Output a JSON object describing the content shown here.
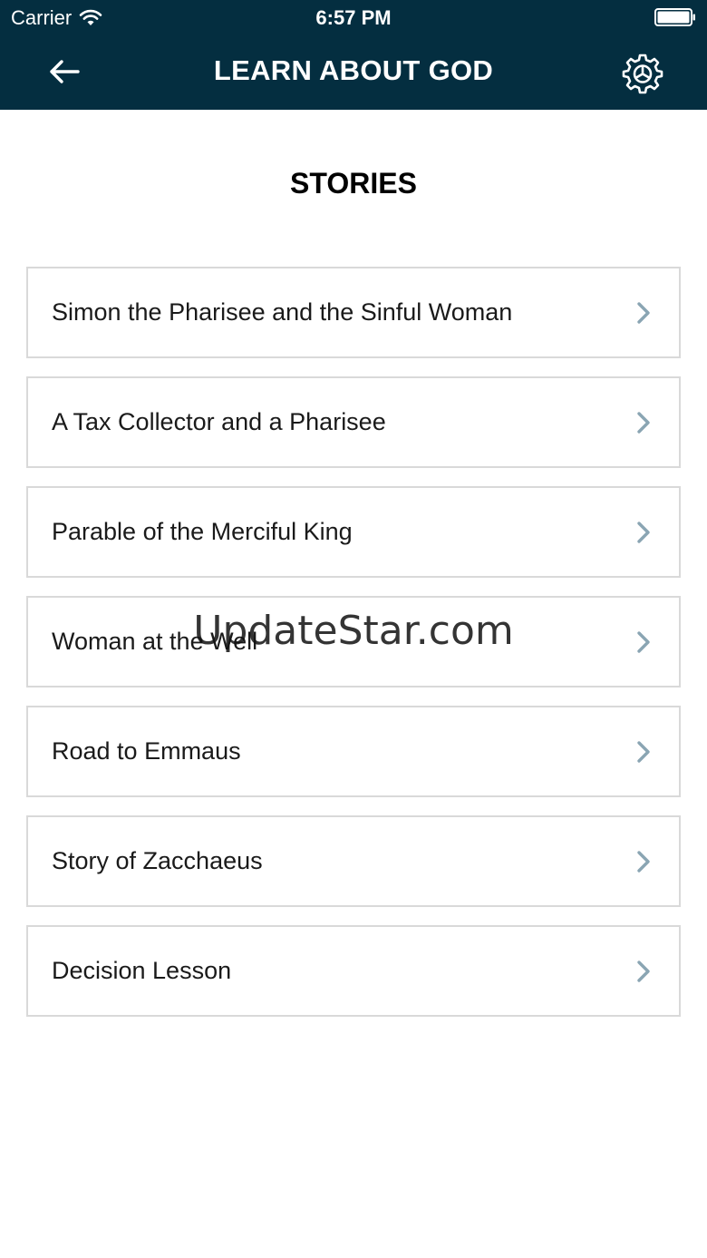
{
  "status_bar": {
    "carrier": "Carrier",
    "time": "6:57 PM"
  },
  "nav": {
    "title": "LEARN ABOUT GOD",
    "back_icon": "back-arrow-icon",
    "settings_icon": "gear-icon"
  },
  "section": {
    "title": "STORIES"
  },
  "stories": [
    {
      "label": "Simon the Pharisee and the Sinful Woman"
    },
    {
      "label": "A Tax Collector and a Pharisee"
    },
    {
      "label": "Parable of the Merciful King"
    },
    {
      "label": "Woman at the Well"
    },
    {
      "label": "Road to Emmaus"
    },
    {
      "label": "Story of Zacchaeus"
    },
    {
      "label": "Decision Lesson"
    }
  ],
  "watermark": "UpdateStar.com",
  "colors": {
    "header": "#042e40",
    "chevron": "#8aa5b3",
    "border": "#d9d9d9"
  }
}
